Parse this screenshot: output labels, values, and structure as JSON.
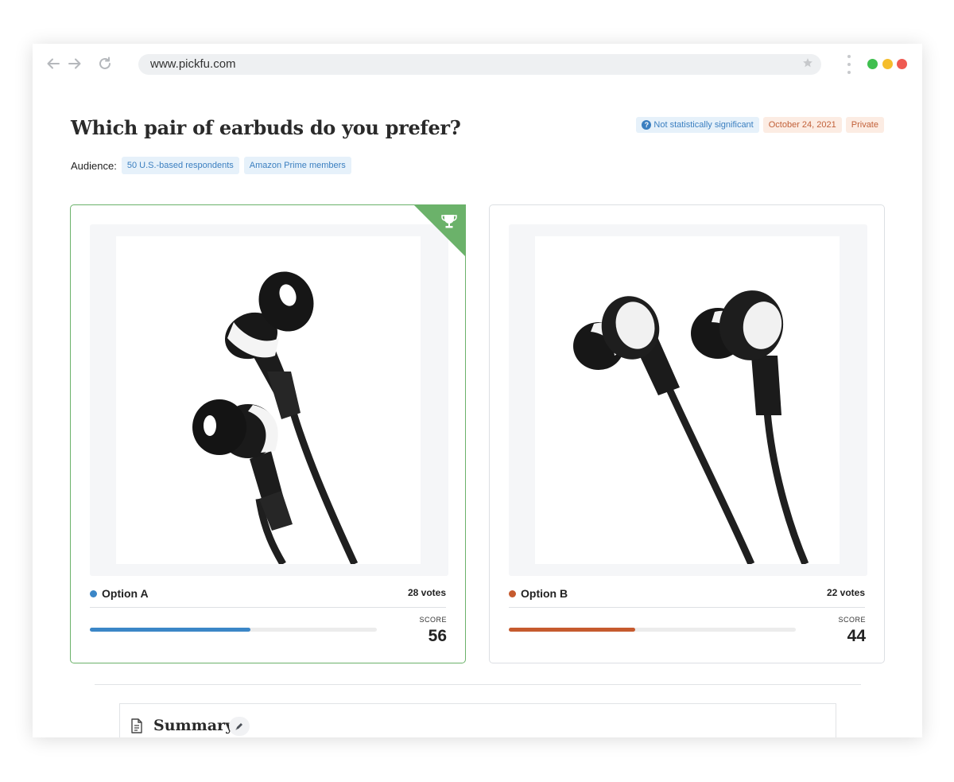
{
  "browser": {
    "url": "www.pickfu.com",
    "icons": [
      "back-arrow-icon",
      "forward-arrow-icon",
      "reload-icon",
      "star-icon",
      "kebab-menu-icon"
    ],
    "traffic_lights": [
      "#3fbf4f",
      "#f5bd2c",
      "#ef5a52"
    ]
  },
  "poll": {
    "title": "Which pair of earbuds do you prefer?",
    "badges": {
      "significance": "Not statistically significant",
      "date": "October 24, 2021",
      "visibility": "Private"
    },
    "audience_label": "Audience:",
    "audience_tags": [
      "50 U.S.-based respondents",
      "Amazon Prime members"
    ]
  },
  "options": [
    {
      "label": "Option A",
      "votes": "28 votes",
      "score_label": "SCORE",
      "score": "56",
      "score_fraction": 0.56,
      "color": "#3b86c7",
      "winner": true,
      "winner_icon": "trophy-icon"
    },
    {
      "label": "Option B",
      "votes": "22 votes",
      "score_label": "SCORE",
      "score": "44",
      "score_fraction": 0.44,
      "color": "#c65a2e",
      "winner": false
    }
  ],
  "summary": {
    "title": "Summary",
    "icon": "document-icon",
    "edit_icon": "pencil-icon"
  },
  "colors": {
    "winner_border": "#6bb26a",
    "badge_blue": "#3b7fc0",
    "badge_orange": "#c2613a"
  }
}
